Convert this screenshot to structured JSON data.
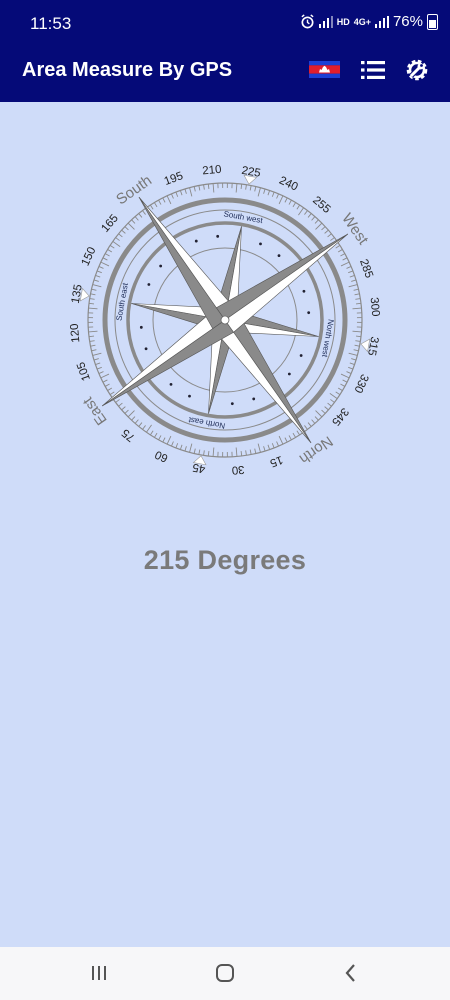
{
  "status_bar": {
    "time": "11:53",
    "hd_label": "HD",
    "net_label": "4G+",
    "battery_percent": "76%",
    "icons": [
      "alarm-icon",
      "signal-icon",
      "signal-icon",
      "battery-icon"
    ]
  },
  "app_bar": {
    "title": "Area Measure By GPS",
    "icons": [
      "cambodia-flag-icon",
      "list-menu-icon",
      "settings-wrench-icon"
    ],
    "color": "#050a78"
  },
  "compass": {
    "heading_deg": 215,
    "cardinal_labels": [
      {
        "text": "South",
        "angle": 180
      },
      {
        "text": "West",
        "angle": 270
      },
      {
        "text": "North",
        "angle": 0
      },
      {
        "text": "East",
        "angle": 90
      }
    ],
    "intercardinal_labels": [
      {
        "text": "South west",
        "angle": 225
      },
      {
        "text": "North west",
        "angle": 315
      },
      {
        "text": "North east",
        "angle": 45
      },
      {
        "text": "South east",
        "angle": 135
      }
    ],
    "degree_labels": [
      "15",
      "30",
      "45",
      "60",
      "75",
      "105",
      "120",
      "135",
      "150",
      "165",
      "195",
      "210",
      "225",
      "240",
      "255",
      "285",
      "300",
      "315",
      "330",
      "345"
    ],
    "face_color": "#8a8a8a"
  },
  "readout": {
    "value": "215 Degrees"
  },
  "nav_bar": {
    "icons": [
      "recent-apps-icon",
      "home-icon",
      "back-icon"
    ]
  }
}
